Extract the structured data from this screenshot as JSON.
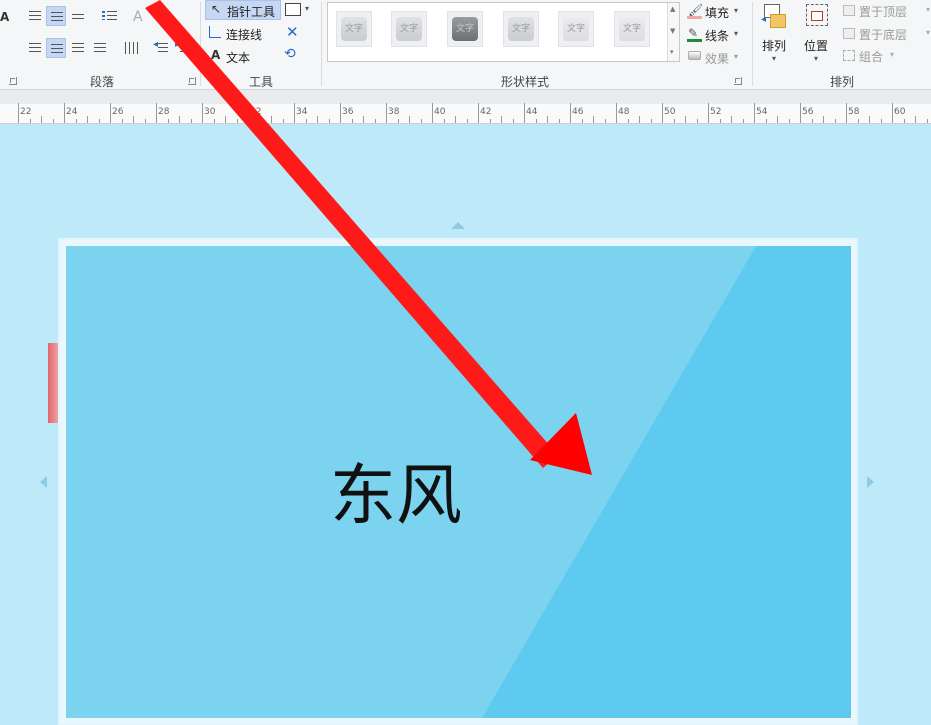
{
  "ribbon": {
    "paragraph": {
      "label": "段落"
    },
    "tools": {
      "label": "工具",
      "pointer": "指针工具",
      "connector": "连接线",
      "text": "文本"
    },
    "shape_styles": {
      "label": "形状样式",
      "swatch_text": "文字",
      "fill": "填充",
      "line": "线条",
      "effect": "效果"
    },
    "arrange": {
      "label": "排列",
      "arrange_btn": "排列",
      "position_btn": "位置",
      "bring_front": "置于顶层",
      "send_back": "置于底层",
      "group": "组合"
    }
  },
  "ruler": {
    "labels": [
      "22",
      "24",
      "26",
      "28",
      "30",
      "32",
      "34",
      "36",
      "38",
      "40",
      "42",
      "44",
      "46",
      "48",
      "50",
      "52",
      "54",
      "56",
      "58",
      "60"
    ]
  },
  "canvas": {
    "shape_text": "东风"
  },
  "colors": {
    "canvas_bg": "#bee9f8",
    "shape_fill": "#7bd3f0",
    "shape_highlight": "#5ecaef",
    "arrow": "#ff0000",
    "selected_button": "#c5d7f3"
  }
}
